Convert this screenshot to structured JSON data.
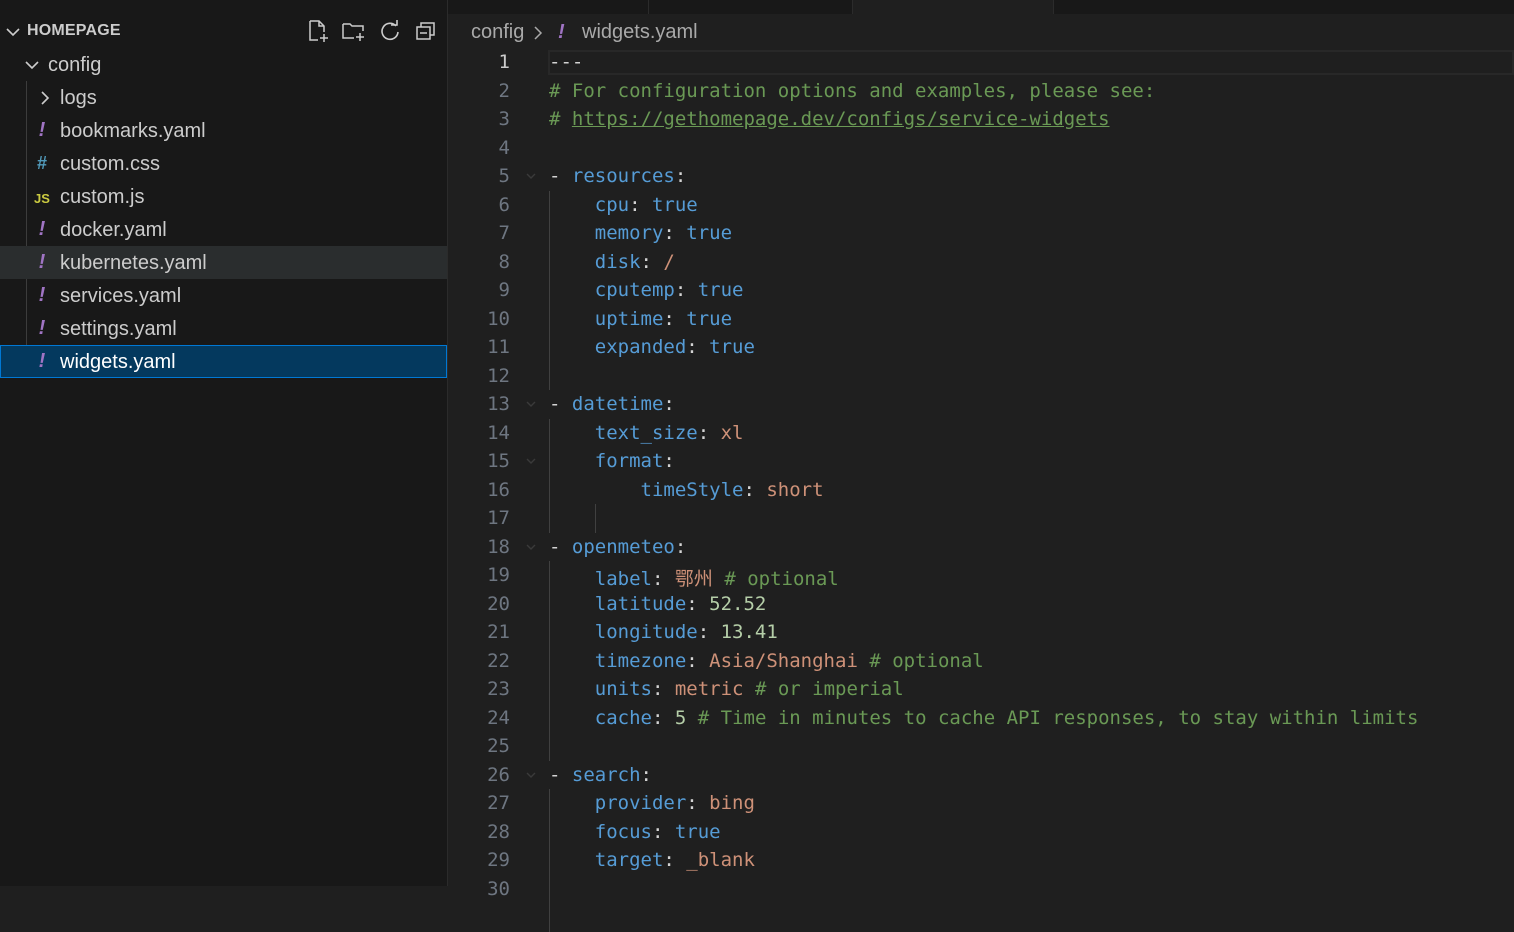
{
  "explorer": {
    "title": "HOMEPAGE",
    "actions": [
      {
        "name": "new-file-icon",
        "label": "New File"
      },
      {
        "name": "new-folder-icon",
        "label": "New Folder"
      },
      {
        "name": "refresh-icon",
        "label": "Refresh"
      },
      {
        "name": "collapse-all-icon",
        "label": "Collapse All"
      }
    ],
    "tree": [
      {
        "label": "config",
        "kind": "folder-open",
        "depth": 1
      },
      {
        "label": "logs",
        "kind": "folder-closed",
        "depth": 2
      },
      {
        "label": "bookmarks.yaml",
        "kind": "yaml",
        "icon_glyph": "!",
        "depth": 2
      },
      {
        "label": "custom.css",
        "kind": "css",
        "icon_glyph": "#",
        "depth": 2
      },
      {
        "label": "custom.js",
        "kind": "js",
        "icon_glyph": "JS",
        "depth": 2
      },
      {
        "label": "docker.yaml",
        "kind": "yaml",
        "icon_glyph": "!",
        "depth": 2
      },
      {
        "label": "kubernetes.yaml",
        "kind": "yaml",
        "icon_glyph": "!",
        "depth": 2,
        "state": "hover"
      },
      {
        "label": "services.yaml",
        "kind": "yaml",
        "icon_glyph": "!",
        "depth": 2
      },
      {
        "label": "settings.yaml",
        "kind": "yaml",
        "icon_glyph": "!",
        "depth": 2
      },
      {
        "label": "widgets.yaml",
        "kind": "yaml",
        "icon_glyph": "!",
        "depth": 2,
        "state": "selected"
      }
    ]
  },
  "breadcrumb": {
    "folder": "config",
    "separator": ">",
    "file_icon": "!",
    "file": "widgets.yaml"
  },
  "colors": {
    "yaml_icon": "#a074c4",
    "css_icon": "#519aba",
    "js_icon": "#cbcb41",
    "comment": "#6a9955",
    "key": "#569cd6",
    "string": "#ce9178",
    "number": "#b5cea8",
    "selection": "#04395e",
    "focus_border": "#0078d4"
  },
  "editor": {
    "active_line": 1,
    "lines": [
      {
        "n": "1",
        "tokens": [
          [
            "punc",
            "---"
          ]
        ]
      },
      {
        "n": "2",
        "tokens": [
          [
            "comment",
            "# For configuration options and examples, please see:"
          ]
        ]
      },
      {
        "n": "3",
        "tokens": [
          [
            "comment",
            "# "
          ],
          [
            "link",
            "https://gethomepage.dev/configs/service-widgets"
          ]
        ]
      },
      {
        "n": "4",
        "tokens": []
      },
      {
        "n": "5",
        "fold": true,
        "tokens": [
          [
            "punc",
            "- "
          ],
          [
            "key",
            "resources"
          ],
          [
            "punc",
            ":"
          ]
        ]
      },
      {
        "n": "6",
        "tokens": [
          [
            "punc",
            "    "
          ],
          [
            "key",
            "cpu"
          ],
          [
            "punc",
            ": "
          ],
          [
            "bool",
            "true"
          ]
        ]
      },
      {
        "n": "7",
        "tokens": [
          [
            "punc",
            "    "
          ],
          [
            "key",
            "memory"
          ],
          [
            "punc",
            ": "
          ],
          [
            "bool",
            "true"
          ]
        ]
      },
      {
        "n": "8",
        "tokens": [
          [
            "punc",
            "    "
          ],
          [
            "key",
            "disk"
          ],
          [
            "punc",
            ": "
          ],
          [
            "str",
            "/"
          ]
        ]
      },
      {
        "n": "9",
        "tokens": [
          [
            "punc",
            "    "
          ],
          [
            "key",
            "cputemp"
          ],
          [
            "punc",
            ": "
          ],
          [
            "bool",
            "true"
          ]
        ]
      },
      {
        "n": "10",
        "tokens": [
          [
            "punc",
            "    "
          ],
          [
            "key",
            "uptime"
          ],
          [
            "punc",
            ": "
          ],
          [
            "bool",
            "true"
          ]
        ]
      },
      {
        "n": "11",
        "tokens": [
          [
            "punc",
            "    "
          ],
          [
            "key",
            "expanded"
          ],
          [
            "punc",
            ": "
          ],
          [
            "bool",
            "true"
          ]
        ]
      },
      {
        "n": "12",
        "tokens": []
      },
      {
        "n": "13",
        "fold": true,
        "tokens": [
          [
            "punc",
            "- "
          ],
          [
            "key",
            "datetime"
          ],
          [
            "punc",
            ":"
          ]
        ]
      },
      {
        "n": "14",
        "tokens": [
          [
            "punc",
            "    "
          ],
          [
            "key",
            "text_size"
          ],
          [
            "punc",
            ": "
          ],
          [
            "str",
            "xl"
          ]
        ]
      },
      {
        "n": "15",
        "fold": true,
        "tokens": [
          [
            "punc",
            "    "
          ],
          [
            "key",
            "format"
          ],
          [
            "punc",
            ":"
          ]
        ]
      },
      {
        "n": "16",
        "tokens": [
          [
            "punc",
            "        "
          ],
          [
            "key",
            "timeStyle"
          ],
          [
            "punc",
            ": "
          ],
          [
            "str",
            "short"
          ]
        ]
      },
      {
        "n": "17",
        "tokens": []
      },
      {
        "n": "18",
        "fold": true,
        "tokens": [
          [
            "punc",
            "- "
          ],
          [
            "key",
            "openmeteo"
          ],
          [
            "punc",
            ":"
          ]
        ]
      },
      {
        "n": "19",
        "tokens": [
          [
            "punc",
            "    "
          ],
          [
            "key",
            "label"
          ],
          [
            "punc",
            ": "
          ],
          [
            "str",
            "鄂州"
          ],
          [
            "comment",
            " # optional"
          ]
        ]
      },
      {
        "n": "20",
        "tokens": [
          [
            "punc",
            "    "
          ],
          [
            "key",
            "latitude"
          ],
          [
            "punc",
            ": "
          ],
          [
            "num",
            "52.52"
          ]
        ]
      },
      {
        "n": "21",
        "tokens": [
          [
            "punc",
            "    "
          ],
          [
            "key",
            "longitude"
          ],
          [
            "punc",
            ": "
          ],
          [
            "num",
            "13.41"
          ]
        ]
      },
      {
        "n": "22",
        "tokens": [
          [
            "punc",
            "    "
          ],
          [
            "key",
            "timezone"
          ],
          [
            "punc",
            ": "
          ],
          [
            "str",
            "Asia/Shanghai"
          ],
          [
            "comment",
            " # optional"
          ]
        ]
      },
      {
        "n": "23",
        "tokens": [
          [
            "punc",
            "    "
          ],
          [
            "key",
            "units"
          ],
          [
            "punc",
            ": "
          ],
          [
            "str",
            "metric"
          ],
          [
            "comment",
            " # or imperial"
          ]
        ]
      },
      {
        "n": "24",
        "tokens": [
          [
            "punc",
            "    "
          ],
          [
            "key",
            "cache"
          ],
          [
            "punc",
            ": "
          ],
          [
            "num",
            "5"
          ],
          [
            "comment",
            " # Time in minutes to cache API responses, to stay within limits"
          ]
        ]
      },
      {
        "n": "25",
        "tokens": []
      },
      {
        "n": "26",
        "fold": true,
        "tokens": [
          [
            "punc",
            "- "
          ],
          [
            "key",
            "search"
          ],
          [
            "punc",
            ":"
          ]
        ]
      },
      {
        "n": "27",
        "tokens": [
          [
            "punc",
            "    "
          ],
          [
            "key",
            "provider"
          ],
          [
            "punc",
            ": "
          ],
          [
            "str",
            "bing"
          ]
        ]
      },
      {
        "n": "28",
        "tokens": [
          [
            "punc",
            "    "
          ],
          [
            "key",
            "focus"
          ],
          [
            "punc",
            ": "
          ],
          [
            "bool",
            "true"
          ]
        ]
      },
      {
        "n": "29",
        "tokens": [
          [
            "punc",
            "    "
          ],
          [
            "key",
            "target"
          ],
          [
            "punc",
            ": "
          ],
          [
            "str",
            "_blank"
          ]
        ]
      },
      {
        "n": "30",
        "tokens": []
      }
    ]
  }
}
